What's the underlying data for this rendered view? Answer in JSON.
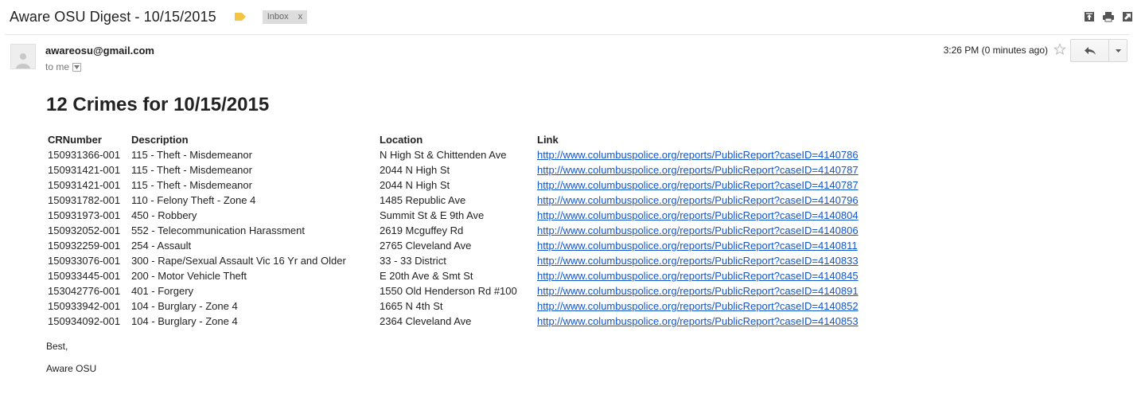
{
  "header": {
    "subject": "Aware OSU Digest - 10/15/2015",
    "label_color": "#f4c542",
    "inbox_chip": {
      "label": "Inbox",
      "close": "x"
    },
    "icons": [
      "open-in-new-window-icon",
      "print-icon",
      "expand-icon"
    ]
  },
  "message": {
    "from": "awareosu@gmail.com",
    "to": "to me",
    "time": "3:26 PM (0 minutes ago)",
    "avatar_icon": "person-silhouette-icon",
    "star_icon": "star-outline-icon",
    "reply_icon": "reply-arrow-icon",
    "more_icon": "caret-down-icon"
  },
  "body": {
    "heading": "12 Crimes for 10/15/2015",
    "columns": [
      "CRNumber",
      "Description",
      "Location",
      "Link"
    ],
    "rows": [
      {
        "cr": "150931366-001",
        "desc": "115 - Theft - Misdemeanor",
        "loc": "N High St & Chittenden Ave",
        "link": "http://www.columbuspolice.org/reports/PublicReport?caseID=4140786"
      },
      {
        "cr": "150931421-001",
        "desc": "115 - Theft - Misdemeanor",
        "loc": "2044 N High St",
        "link": "http://www.columbuspolice.org/reports/PublicReport?caseID=4140787"
      },
      {
        "cr": "150931421-001",
        "desc": "115 - Theft - Misdemeanor",
        "loc": "2044 N High St",
        "link": "http://www.columbuspolice.org/reports/PublicReport?caseID=4140787"
      },
      {
        "cr": "150931782-001",
        "desc": "110 - Felony Theft - Zone 4",
        "loc": "1485 Republic Ave",
        "link": "http://www.columbuspolice.org/reports/PublicReport?caseID=4140796"
      },
      {
        "cr": "150931973-001",
        "desc": "450 - Robbery",
        "loc": "Summit St & E 9th Ave",
        "link": "http://www.columbuspolice.org/reports/PublicReport?caseID=4140804"
      },
      {
        "cr": "150932052-001",
        "desc": "552 - Telecommunication Harassment",
        "loc": "2619 Mcguffey Rd",
        "link": "http://www.columbuspolice.org/reports/PublicReport?caseID=4140806"
      },
      {
        "cr": "150932259-001",
        "desc": "254 - Assault",
        "loc": "2765 Cleveland Ave",
        "link": "http://www.columbuspolice.org/reports/PublicReport?caseID=4140811"
      },
      {
        "cr": "150933076-001",
        "desc": "300 - Rape/Sexual Assault Vic 16 Yr and Older",
        "loc": "33 - 33 District",
        "link": "http://www.columbuspolice.org/reports/PublicReport?caseID=4140833"
      },
      {
        "cr": "150933445-001",
        "desc": "200 - Motor Vehicle Theft",
        "loc": "E 20th Ave & Smt St",
        "link": "http://www.columbuspolice.org/reports/PublicReport?caseID=4140845"
      },
      {
        "cr": "153042776-001",
        "desc": "401 - Forgery",
        "loc": "1550 Old Henderson Rd #100",
        "link": "http://www.columbuspolice.org/reports/PublicReport?caseID=4140891"
      },
      {
        "cr": "150933942-001",
        "desc": "104 - Burglary - Zone 4",
        "loc": "1665 N 4th St",
        "link": "http://www.columbuspolice.org/reports/PublicReport?caseID=4140852"
      },
      {
        "cr": "150934092-001",
        "desc": "104 - Burglary - Zone 4",
        "loc": "2364 Cleveland Ave",
        "link": "http://www.columbuspolice.org/reports/PublicReport?caseID=4140853"
      }
    ],
    "closing": "Best,",
    "signature": "Aware OSU"
  }
}
